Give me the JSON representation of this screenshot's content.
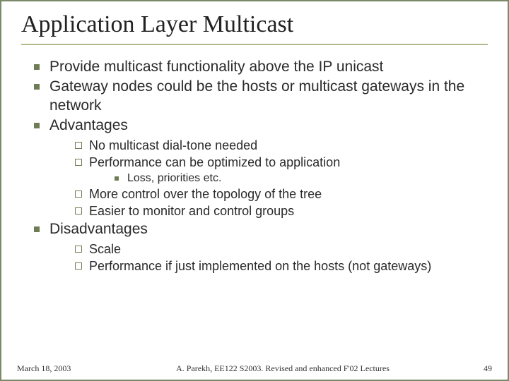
{
  "title": "Application Layer Multicast",
  "bullets": {
    "b1": "Provide multicast functionality above the IP unicast",
    "b2": "Gateway nodes could be the hosts or multicast gateways in the network",
    "b3": "Advantages",
    "b3_sub": {
      "s1": "No multicast dial-tone needed",
      "s2": "Performance can be optimized to application",
      "s2_sub": {
        "t1": "Loss, priorities etc."
      },
      "s3": "More control over the topology of the tree",
      "s4": "Easier to monitor and control groups"
    },
    "b4": "Disadvantages",
    "b4_sub": {
      "s1": "Scale",
      "s2": "Performance if just implemented on the hosts (not gateways)"
    }
  },
  "footer": {
    "date": "March 18, 2003",
    "center": "A. Parekh, EE122 S2003. Revised and enhanced  F'02 Lectures",
    "page": "49"
  }
}
